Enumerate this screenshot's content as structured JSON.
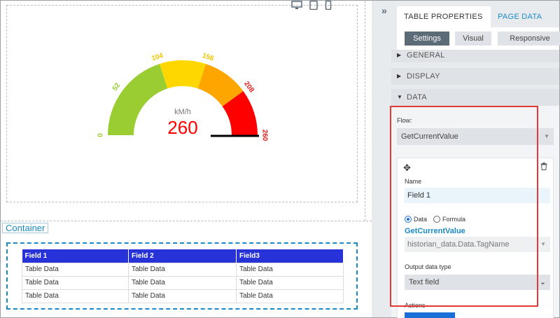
{
  "gauge": {
    "unit": "kM/h",
    "value": 260,
    "min": 0,
    "max": 260,
    "value_color": "#ff0000",
    "ticks": [
      "0",
      "52",
      "104",
      "156",
      "208",
      "260"
    ],
    "bands": [
      {
        "from": 0,
        "to": 104,
        "color": "#9acd32"
      },
      {
        "from": 104,
        "to": 156,
        "color": "#ffd700"
      },
      {
        "from": 156,
        "to": 208,
        "color": "#ffa500"
      },
      {
        "from": 208,
        "to": 260,
        "color": "#ff0000"
      }
    ],
    "tick_colors": [
      "#9acd32",
      "#9acd32",
      "#f0c400",
      "#f0c400",
      "#e02020",
      "#e02020"
    ]
  },
  "device_icons": [
    "desktop-icon",
    "tablet-icon",
    "phone-icon"
  ],
  "container": {
    "label": "Container"
  },
  "table": {
    "headers": [
      "Field 1",
      "Field 2",
      "Field3"
    ],
    "rows": [
      [
        "Table Data",
        "Table Data",
        "Table Data"
      ],
      [
        "Table Data",
        "Table Data",
        "Table Data"
      ],
      [
        "Table Data",
        "Table Data",
        "Table Data"
      ]
    ],
    "header_color": "#2732d9"
  },
  "panel": {
    "collapse_icon": "double-chevron-right-icon",
    "tabs": [
      "TABLE PROPERTIES",
      "PAGE DATA"
    ],
    "subtabs": [
      "Settings",
      "Visual",
      "Responsive"
    ],
    "sections": [
      "GENERAL",
      "DISPLAY",
      "DATA"
    ],
    "flow_label": "Flow:",
    "flow_value": "GetCurrentValue",
    "name_label": "Name",
    "name_value": "Field 1",
    "radio_data": "Data",
    "radio_formula": "Formula",
    "method_name": "GetCurrentValue",
    "tag_value": "historian_data.Data.TagName",
    "output_label": "Output data type",
    "output_value": "Text field",
    "actions_label": "Actions"
  }
}
